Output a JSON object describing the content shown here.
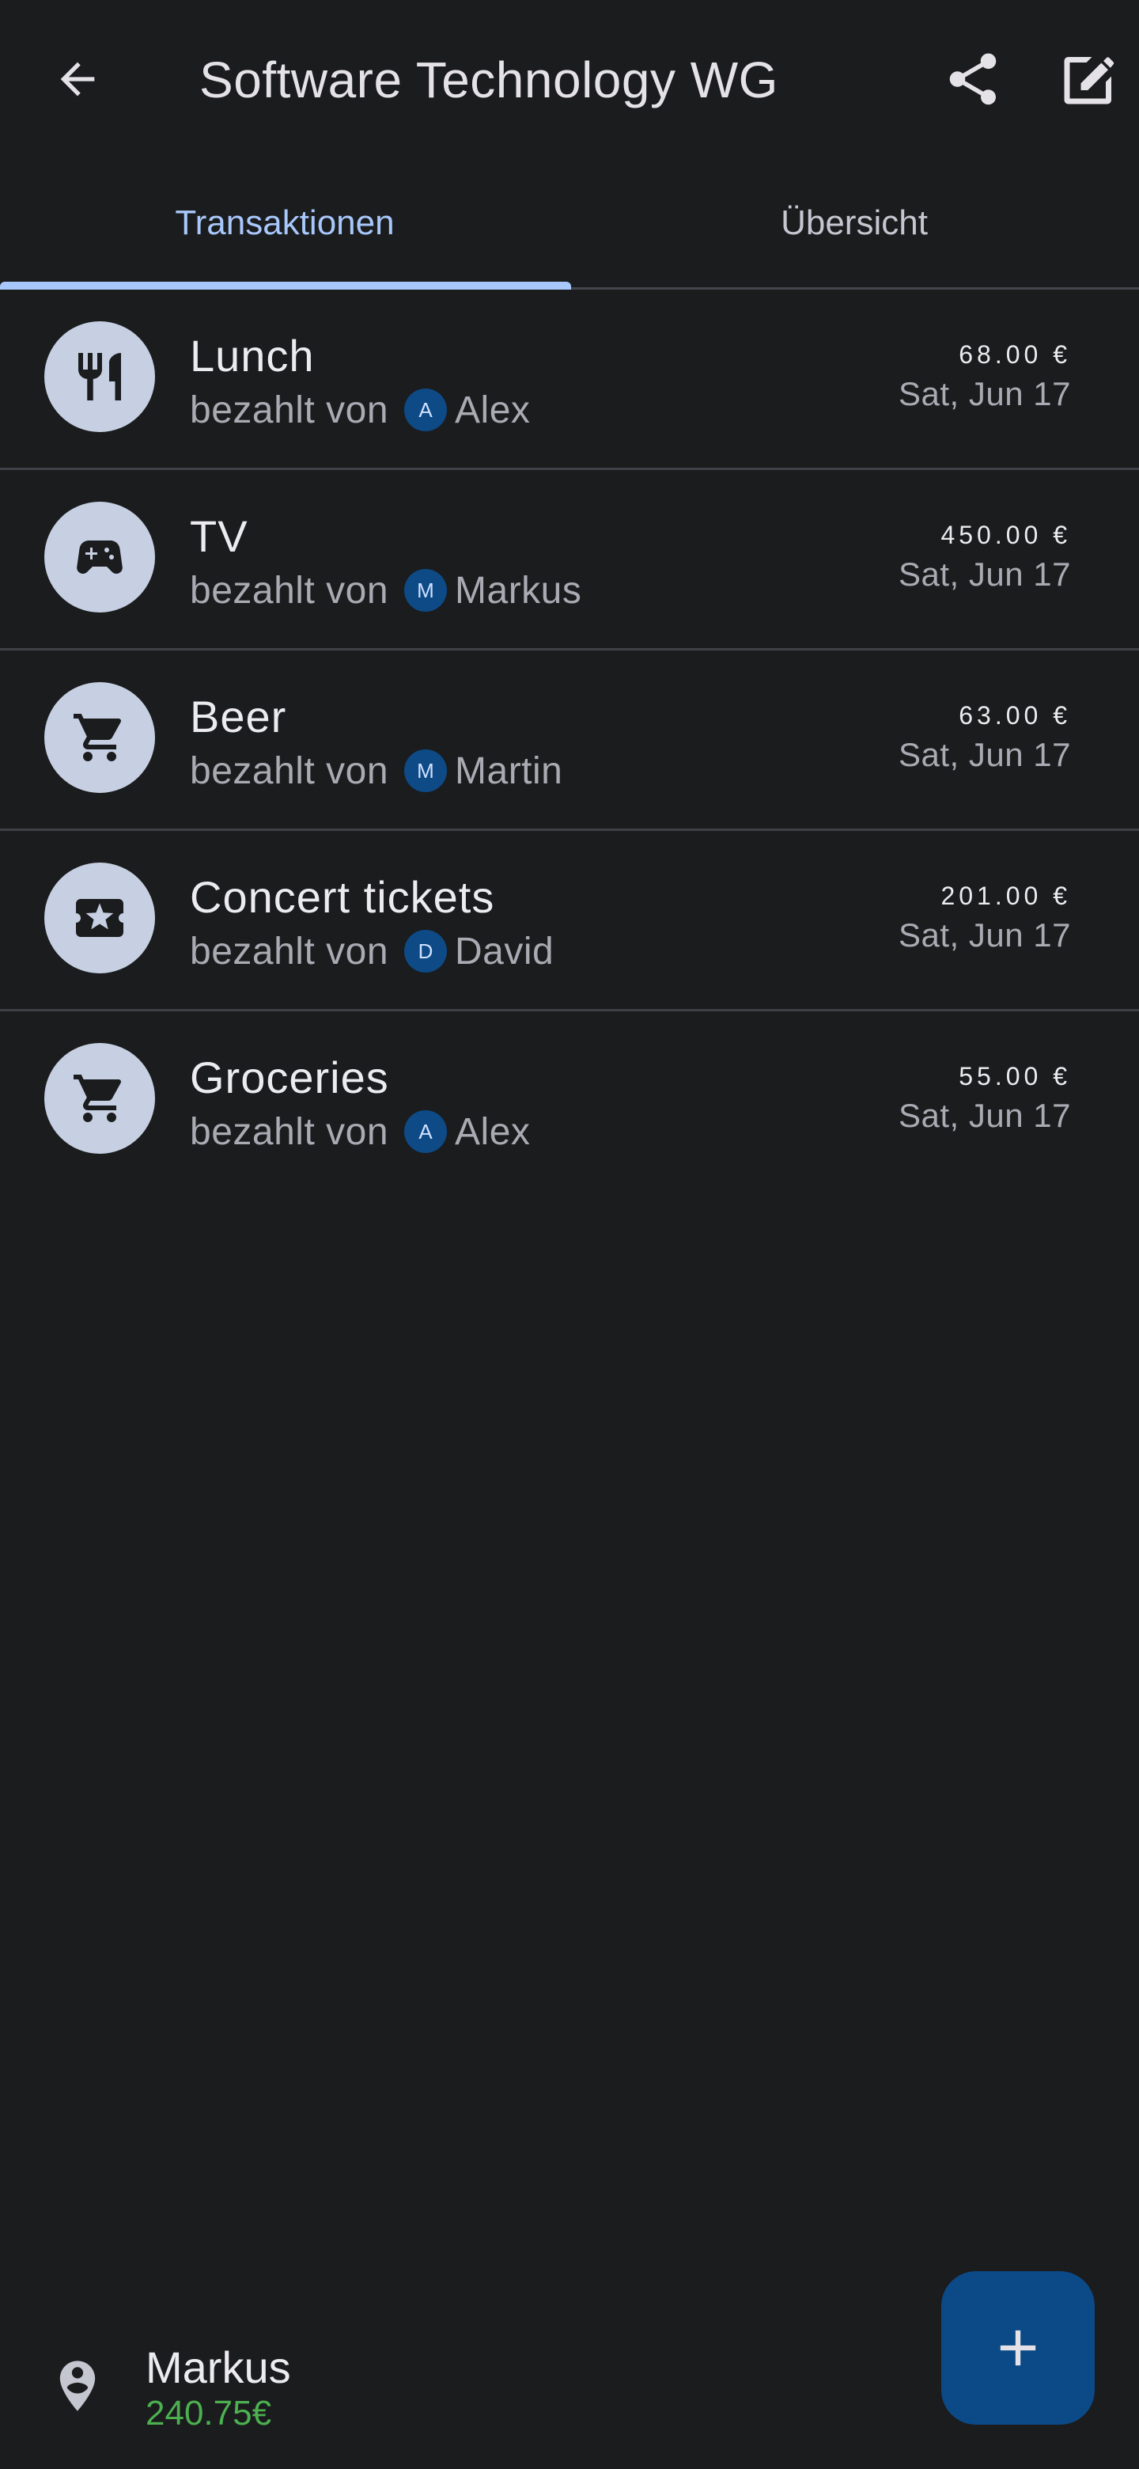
{
  "header": {
    "title": "Software Technology WG",
    "back_icon": "arrow-back-icon",
    "share_icon": "share-icon",
    "edit_icon": "edit-icon"
  },
  "tabs": [
    {
      "label": "Transaktionen",
      "active": true
    },
    {
      "label": "Übersicht",
      "active": false
    }
  ],
  "transactions": [
    {
      "title": "Lunch",
      "paid_by_label": "bezahlt von",
      "payer_initial": "A",
      "payer": "Alex",
      "amount": "68.00 €",
      "date": "Sat, Jun 17",
      "icon": "restaurant-icon"
    },
    {
      "title": "TV",
      "paid_by_label": "bezahlt von",
      "payer_initial": "M",
      "payer": "Markus",
      "amount": "450.00 €",
      "date": "Sat, Jun 17",
      "icon": "gamepad-icon"
    },
    {
      "title": "Beer",
      "paid_by_label": "bezahlt von",
      "payer_initial": "M",
      "payer": "Martin",
      "amount": "63.00 €",
      "date": "Sat, Jun 17",
      "icon": "shopping-cart-icon"
    },
    {
      "title": "Concert tickets",
      "paid_by_label": "bezahlt von",
      "payer_initial": "D",
      "payer": "David",
      "amount": "201.00 €",
      "date": "Sat, Jun 17",
      "icon": "ticket-icon"
    },
    {
      "title": "Groceries",
      "paid_by_label": "bezahlt von",
      "payer_initial": "A",
      "payer": "Alex",
      "amount": "55.00 €",
      "date": "Sat, Jun 17",
      "icon": "shopping-cart-icon"
    }
  ],
  "current_user": {
    "name": "Markus",
    "balance": "240.75€",
    "icon": "person-pin-icon"
  },
  "fab": {
    "icon": "add-icon"
  },
  "colors": {
    "background": "#1b1c1e",
    "accent": "#a8c7fa",
    "fab": "#0b4a87",
    "avatar": "#0d4a86",
    "positive_balance": "#4caf50"
  }
}
